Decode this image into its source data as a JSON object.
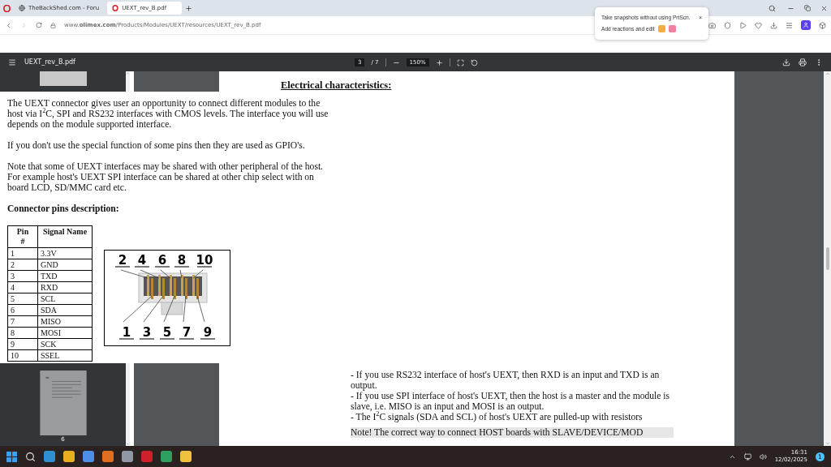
{
  "browser": {
    "tabs": [
      {
        "title": "TheBackShed.com - Foru",
        "selected": false
      },
      {
        "title": "UEXT_rev_B.pdf",
        "selected": true
      }
    ],
    "url": "www.**olimex.com**/Products/Modules/UEXT/resources/UEXT_rev_B.pdf"
  },
  "popup": {
    "title": "Take snapshots without using PrtScn.",
    "close": "×",
    "text": "Add reactions and edit"
  },
  "pdf_toolbar": {
    "file_name": "UEXT_rev_B.pdf",
    "page": "3",
    "page_count": "/ 7",
    "zoom": "150%"
  },
  "document": {
    "heading": "Electrical characteristics:",
    "paragraphs": [
      "The UEXT connector gives user an opportunity to connect different modules to the host via I$^{2}$C, SPI and RS232 interfaces with CMOS levels. The interface you will use depends on the module supported interface.",
      "If you don't use the special function of some pins then they are used as GPIO's.",
      "Note that some of UEXT interfaces may be shared with other peripheral of the host. For example host's UEXT SPI interface can be shared at other chip select with on board  LCD, SD/MMC card etc."
    ],
    "subheading": "Connector pins description:",
    "table": {
      "columns": [
        "Pin\n#",
        "Signal Name"
      ],
      "rows": [
        [
          "1",
          "3.3V"
        ],
        [
          "2",
          "GND"
        ],
        [
          "3",
          "TXD"
        ],
        [
          "4",
          "RXD"
        ],
        [
          "5",
          "SCL"
        ],
        [
          "6",
          "SDA"
        ],
        [
          "7",
          "MISO"
        ],
        [
          "8",
          "MOSI"
        ],
        [
          "9",
          "SCK"
        ],
        [
          "10",
          "SSEL"
        ]
      ]
    },
    "connector": {
      "top_labels": [
        "2",
        "4",
        "6",
        "8",
        "10"
      ],
      "bottom_labels": [
        "1",
        "3",
        "5",
        "7",
        "9"
      ]
    },
    "bullets": [
      "- If you use RS232 interface of host's UEXT, then RXD is an input and TXD is an output.",
      "- If you use SPI interface of host's UEXT, then the host is a master and the module is slave, i.e. MISO is an input and MOSI is an output.",
      "- The I$^{2}$C signals (SDA and SCL) of host's UEXT are pulled-up with resistors"
    ],
    "note": "Note! The correct way to connect HOST boards with SLAVE/DEVICE/MOD"
  },
  "sidebar": {
    "thumbnail_page": "6"
  },
  "taskbar": {
    "time": "16:31",
    "date": "12/02/2025",
    "notifications": "1"
  }
}
